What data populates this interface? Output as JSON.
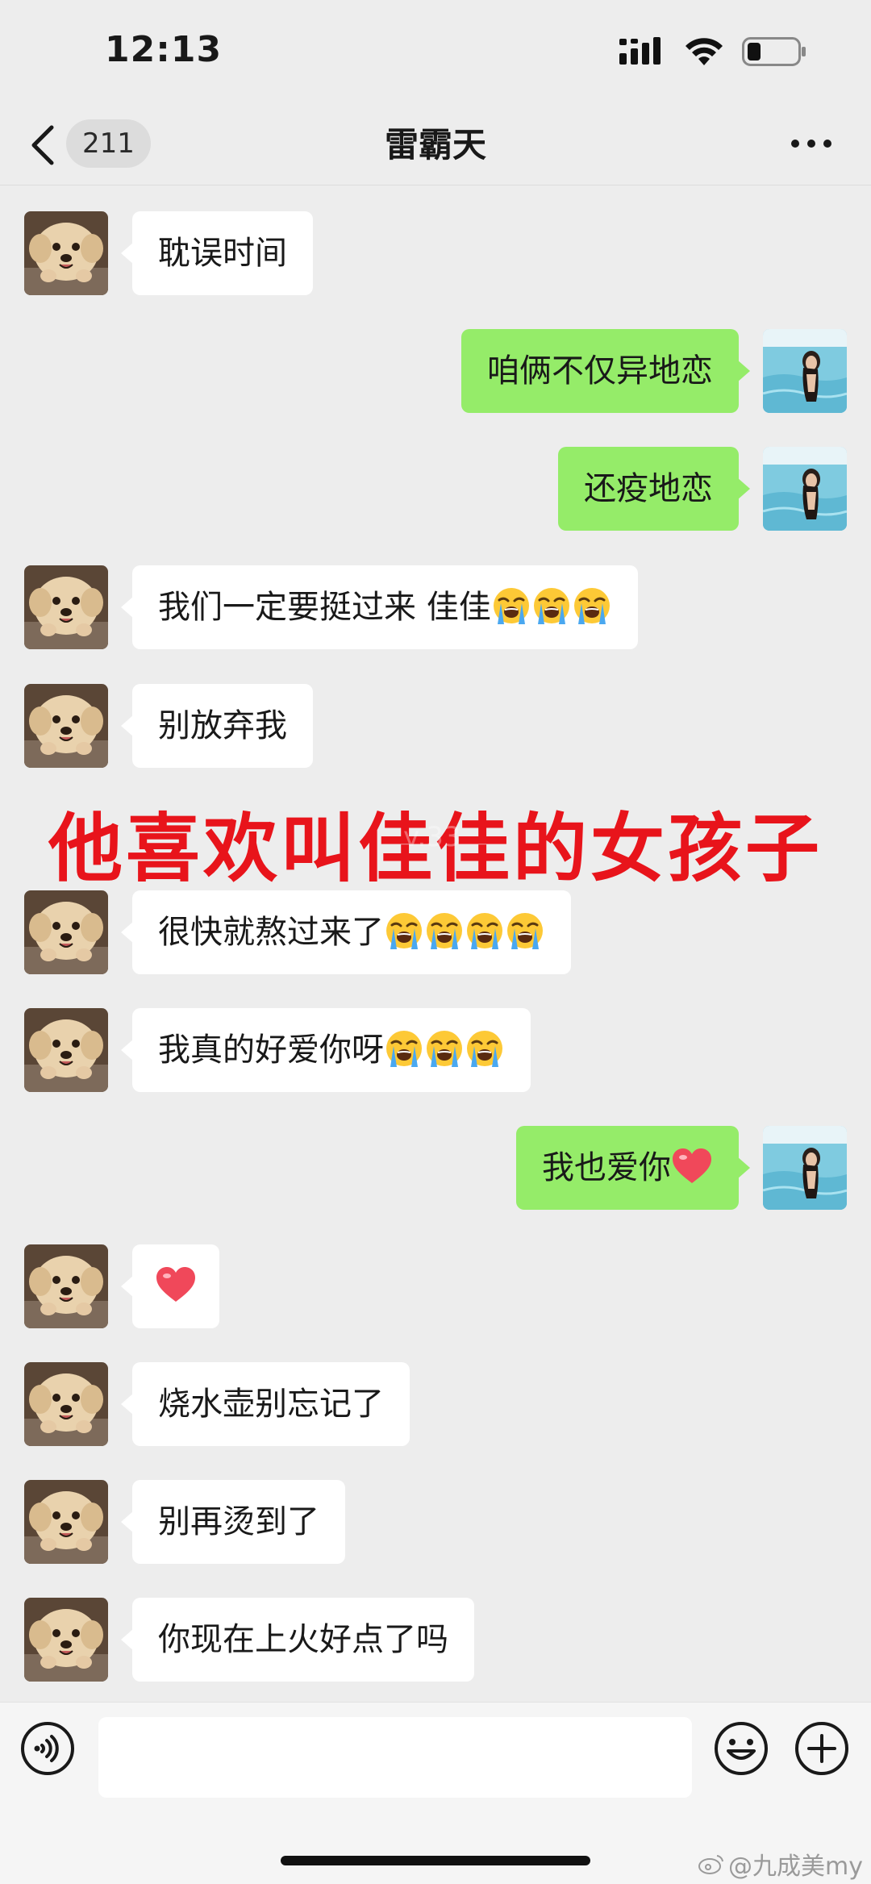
{
  "status_bar": {
    "time": "12:13"
  },
  "nav": {
    "back_count": "211",
    "title": "雷霸天"
  },
  "messages": [
    {
      "side": "left",
      "text": "耽误时间",
      "emoji": "",
      "emoji_count": 0,
      "heart": false
    },
    {
      "side": "right",
      "text": "咱俩不仅异地恋",
      "emoji": "",
      "emoji_count": 0,
      "heart": false
    },
    {
      "side": "right",
      "text": "还疫地恋",
      "emoji": "",
      "emoji_count": 0,
      "heart": false
    },
    {
      "side": "left",
      "text": "我们一定要挺过来 佳佳",
      "emoji": "loudly-crying-face",
      "emoji_count": 3,
      "heart": false
    },
    {
      "side": "left",
      "text": "别放弃我",
      "emoji": "",
      "emoji_count": 0,
      "heart": false
    },
    {
      "side": "left",
      "text": "很快就熬过来了",
      "emoji": "loudly-crying-face",
      "emoji_count": 4,
      "heart": false
    },
    {
      "side": "left",
      "text": "我真的好爱你呀",
      "emoji": "loudly-crying-face",
      "emoji_count": 3,
      "heart": false
    },
    {
      "side": "right",
      "text": "我也爱你",
      "emoji": "",
      "emoji_count": 0,
      "heart": true
    },
    {
      "side": "left",
      "text": "",
      "emoji": "",
      "emoji_count": 0,
      "heart": true
    },
    {
      "side": "left",
      "text": "烧水壶别忘记了",
      "emoji": "",
      "emoji_count": 0,
      "heart": false
    },
    {
      "side": "left",
      "text": "别再烫到了",
      "emoji": "",
      "emoji_count": 0,
      "heart": false
    },
    {
      "side": "left",
      "text": "你现在上火好点了吗",
      "emoji": "",
      "emoji_count": 0,
      "heart": false
    }
  ],
  "overlay": {
    "caption": "他喜欢叫佳佳的女孩子",
    "faint_mark": "v.33"
  },
  "input_bar": {
    "placeholder": ""
  },
  "watermark": {
    "text": "@九成美my"
  },
  "colors": {
    "background": "#ededed",
    "sent_bubble": "#95ec69",
    "received_bubble": "#ffffff",
    "caption": "#e8141b"
  },
  "icons": [
    "chevron-left-icon",
    "more-icon",
    "voice-icon",
    "emoji-icon",
    "plus-icon",
    "weibo-icon"
  ]
}
